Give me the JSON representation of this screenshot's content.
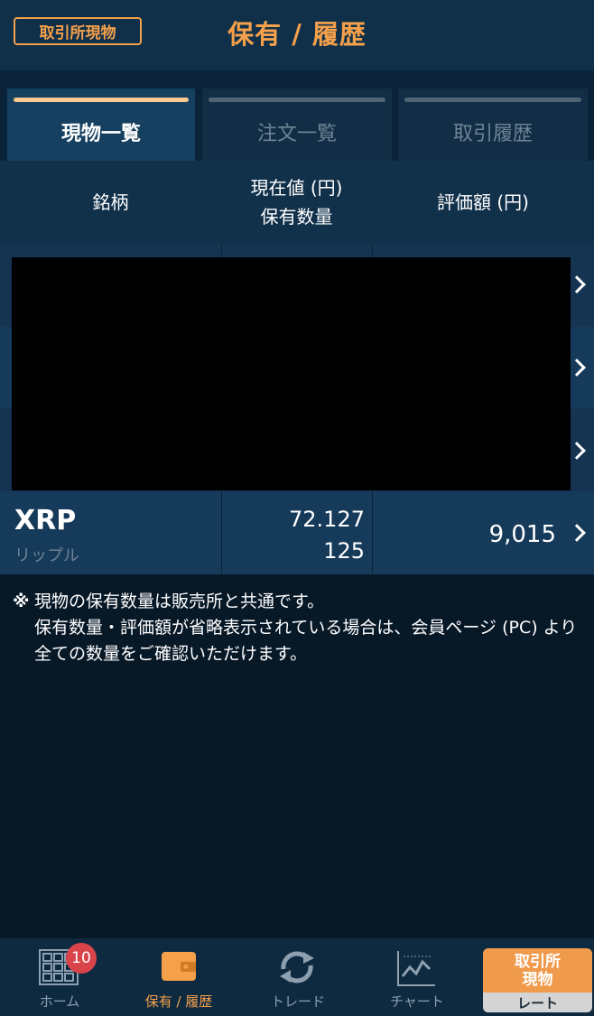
{
  "header": {
    "exchange_badge": "取引所現物",
    "title": "保有 / 履歴"
  },
  "tabs": [
    {
      "label": "現物一覧",
      "active": true
    },
    {
      "label": "注文一覧",
      "active": false
    },
    {
      "label": "取引履歴",
      "active": false
    }
  ],
  "table": {
    "col_symbol": "銘柄",
    "col_price": "現在値 (円)",
    "col_qty": "保有数量",
    "col_value": "評価額 (円)"
  },
  "holdings": [
    {
      "symbol": "XRP",
      "name": "リップル",
      "price": "72.127",
      "qty": "125",
      "value": "9,015"
    }
  ],
  "note": {
    "mark": "※",
    "line1": "現物の保有数量は販売所と共通です。",
    "line2": "保有数量・評価額が省略表示されている場合は、会員ページ (PC) より全ての数量をご確認いただけます。"
  },
  "bottom_nav": {
    "home": "ホーム",
    "home_badge": "10",
    "holdings": "保有 / 履歴",
    "trade": "トレード",
    "chart": "チャート",
    "rate_top1": "取引所",
    "rate_top2": "現物",
    "rate_bottom": "レート"
  },
  "colors": {
    "accent": "#f5a04a",
    "background": "#071827",
    "row": "#143452"
  },
  "icons": [
    "grid-icon",
    "wallet-icon",
    "refresh-icon",
    "chart-icon",
    "chevron-right-icon"
  ]
}
